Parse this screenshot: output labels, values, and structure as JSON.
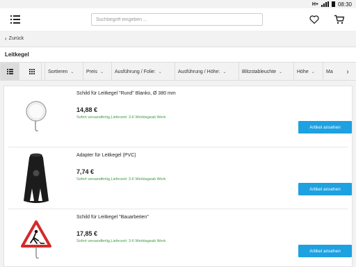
{
  "status": {
    "network": "H+",
    "time": "08:30"
  },
  "header": {
    "search_placeholder": "Suchbegriff eingeben ..."
  },
  "back": {
    "label": "Zurück"
  },
  "category": {
    "title": "Leitkegel"
  },
  "filters": [
    {
      "label": "Sortieren"
    },
    {
      "label": "Preis"
    },
    {
      "label": "Ausführung / Folie:"
    },
    {
      "label": "Ausführung / Höhe:"
    },
    {
      "label": "Blitzstableuchte"
    },
    {
      "label": "Höhe"
    },
    {
      "label": "Ma"
    }
  ],
  "products": [
    {
      "name": "Schild für Leitkegel \"Rund\" Blanko, Ø 380 mm",
      "price": "14,88 €",
      "availability": "Sofort versandfertig,Lieferzeit: 3-6 Werktageab Werk",
      "button": "Artikel ansehen",
      "image_icon": "round-sign-icon"
    },
    {
      "name": "Adapter für Leitkegel (PVC)",
      "price": "7,74 €",
      "availability": "Sofort versandfertig,Lieferzeit: 3-6 Werktageab Werk",
      "button": "Artikel ansehen",
      "image_icon": "adapter-icon"
    },
    {
      "name": "Schild für Leitkegel \"Bauarbeiten\"",
      "price": "17,85 €",
      "availability": "Sofort versandfertig,Lieferzeit: 3-6 Werktageab Werk",
      "button": "Artikel ansehen",
      "image_icon": "roadwork-sign-icon"
    }
  ],
  "colors": {
    "accent": "#1da1e1",
    "availability": "#3c9a43",
    "warning_red": "#d42a2a"
  }
}
